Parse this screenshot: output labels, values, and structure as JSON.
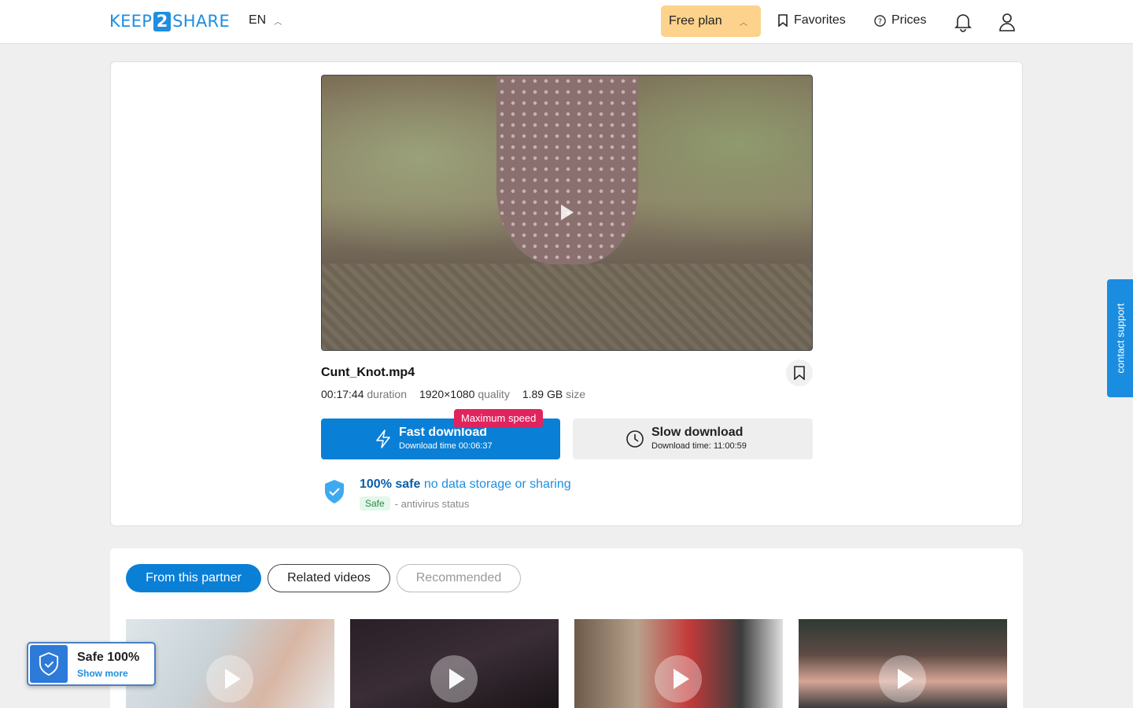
{
  "header": {
    "logo_left": "KEEP",
    "logo_mid": "2",
    "logo_right": "SHARE",
    "language": "EN",
    "plan_label": "Free plan",
    "favorites_label": "Favorites",
    "prices_label": "Prices",
    "icons": [
      "chevron-up-icon",
      "bookmark-icon",
      "help-circle-icon",
      "bell-icon",
      "user-icon"
    ]
  },
  "file": {
    "name": "Cunt_Knot.mp4",
    "duration_value": "00:17:44",
    "duration_label": "duration",
    "quality_value": "1920×1080",
    "quality_label": "quality",
    "size_value": "1.89 GB",
    "size_label": "size"
  },
  "downloads": {
    "fast_title": "Fast download",
    "fast_time": "Download time 00:06:37",
    "fast_badge": "Maximum speed",
    "slow_title": "Slow download",
    "slow_time": "Download time: 11:00:59"
  },
  "safety": {
    "strong": "100% safe",
    "weak": "no data storage or sharing",
    "status_pill": "Safe",
    "status_text": "- antivirus status"
  },
  "tabs": [
    "From this partner",
    "Related videos",
    "Recommended"
  ],
  "side": {
    "contact": "contact support"
  },
  "safe_widget": {
    "title": "Safe 100%",
    "more": "Show more"
  },
  "colors": {
    "accent": "#0a7fd6",
    "plan_bg": "#fcd28c",
    "badge": "#e0245e"
  }
}
